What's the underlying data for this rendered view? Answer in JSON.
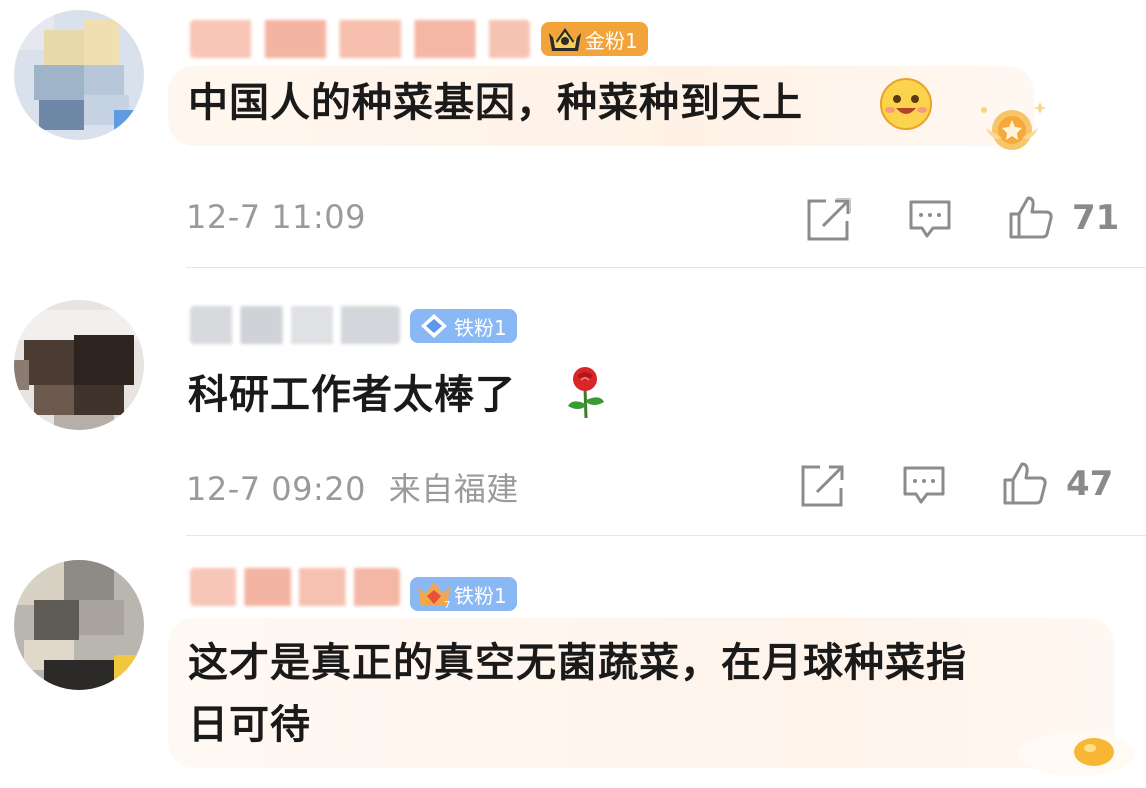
{
  "comments": [
    {
      "badge": "金粉1",
      "text": "中国人的种菜基因，种菜种到天上",
      "time": "12-7 11:09",
      "location": "",
      "likes": "71",
      "badge_color": "#f2a33a"
    },
    {
      "badge": "铁粉1",
      "text": "科研工作者太棒了",
      "time": "12-7 09:20",
      "location": "来自福建",
      "likes": "47",
      "badge_color": "#8ab8f5"
    },
    {
      "badge": "铁粉1",
      "line1": "这才是真正的真空无菌蔬菜，在月球种菜指",
      "line2": "日可待",
      "badge_color": "#8ab8f5"
    }
  ],
  "icons": {
    "share": "share-icon",
    "comment": "comment-icon",
    "like": "thumbs-up-icon",
    "emoji_happy": "happy-face-emoji-icon",
    "emoji_rose": "rose-emoji-icon",
    "crown": "crown-icon",
    "diamond": "diamond-icon"
  }
}
